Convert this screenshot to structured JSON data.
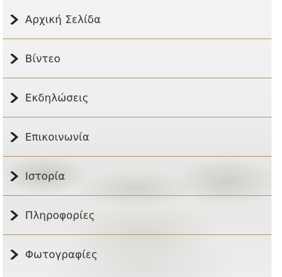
{
  "menu": {
    "items": [
      {
        "label": "Αρχική Σελίδα",
        "icon": "chevron-right-icon"
      },
      {
        "label": "Βίντεο",
        "icon": "chevron-right-icon"
      },
      {
        "label": "Εκδηλώσεις",
        "icon": "chevron-right-icon"
      },
      {
        "label": "Επικοινωνία",
        "icon": "chevron-right-icon"
      },
      {
        "label": "Ιστορία",
        "icon": "chevron-right-icon"
      },
      {
        "label": "Πληροφορίες",
        "icon": "chevron-right-icon"
      },
      {
        "label": "Φωτογραφίες",
        "icon": "chevron-right-icon"
      }
    ],
    "colors": {
      "divider": "#b39a72",
      "text": "#333333",
      "chevron": "#222222"
    }
  }
}
